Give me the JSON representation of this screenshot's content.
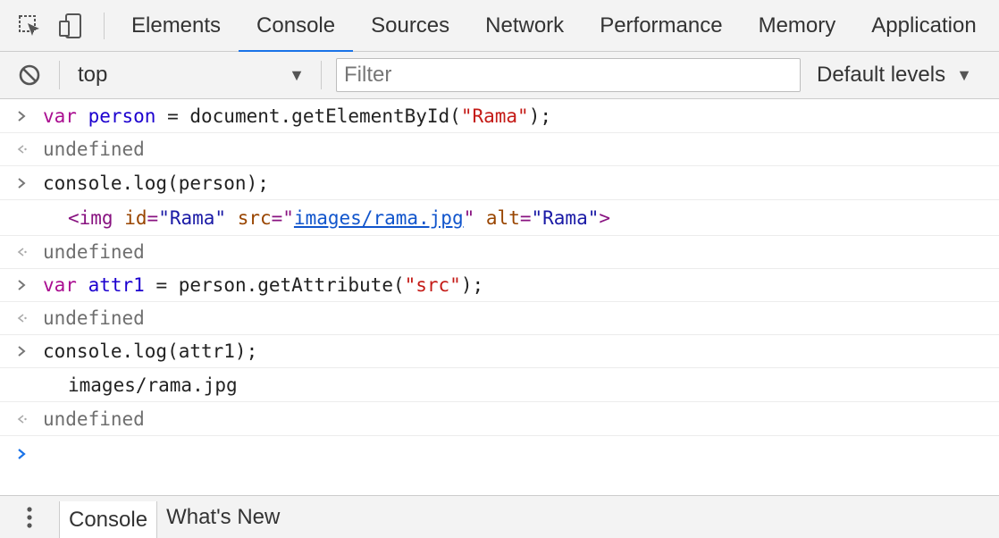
{
  "tabs": {
    "inspect_icon": "inspect-element-icon",
    "device_icon": "device-toolbar-icon",
    "items": [
      "Elements",
      "Console",
      "Sources",
      "Network",
      "Performance",
      "Memory",
      "Application"
    ],
    "active": "Console",
    "accent_color": "#1a73e8"
  },
  "toolbar": {
    "clear_icon": "clear-console-icon",
    "context": "top",
    "filter_placeholder": "Filter",
    "levels_label": "Default levels"
  },
  "console": {
    "lines": [
      {
        "type": "input",
        "segments": [
          [
            "kw",
            "var"
          ],
          [
            "plain",
            " "
          ],
          [
            "var",
            "person"
          ],
          [
            "plain",
            " = document.getElementById("
          ],
          [
            "str",
            "\"Rama\""
          ],
          [
            "plain",
            ");"
          ]
        ]
      },
      {
        "type": "result",
        "text": "undefined"
      },
      {
        "type": "input",
        "segments": [
          [
            "plain",
            "console.log(person);"
          ]
        ]
      },
      {
        "type": "log",
        "segments": [
          [
            "tag",
            "<img"
          ],
          [
            "plain",
            " "
          ],
          [
            "attr",
            "id"
          ],
          [
            "tag",
            "="
          ],
          [
            "aval",
            "\"Rama\""
          ],
          [
            "plain",
            " "
          ],
          [
            "attr",
            "src"
          ],
          [
            "tag",
            "=\""
          ],
          [
            "link",
            "images/rama.jpg"
          ],
          [
            "tag",
            "\""
          ],
          [
            "plain",
            " "
          ],
          [
            "attr",
            "alt"
          ],
          [
            "tag",
            "="
          ],
          [
            "aval",
            "\"Rama\""
          ],
          [
            "tag",
            ">"
          ]
        ]
      },
      {
        "type": "result",
        "text": "undefined"
      },
      {
        "type": "input",
        "segments": [
          [
            "kw",
            "var"
          ],
          [
            "plain",
            " "
          ],
          [
            "var",
            "attr1"
          ],
          [
            "plain",
            " = person.getAttribute("
          ],
          [
            "str",
            "\"src\""
          ],
          [
            "plain",
            ");"
          ]
        ]
      },
      {
        "type": "result",
        "text": "undefined"
      },
      {
        "type": "input",
        "segments": [
          [
            "plain",
            "console.log(attr1);"
          ]
        ]
      },
      {
        "type": "log",
        "segments": [
          [
            "plain",
            "images/rama.jpg"
          ]
        ]
      },
      {
        "type": "result",
        "text": "undefined"
      }
    ]
  },
  "drawer": {
    "menu_icon": "more-vertical-icon",
    "tabs": [
      "Console",
      "What's New"
    ],
    "active": "Console"
  }
}
